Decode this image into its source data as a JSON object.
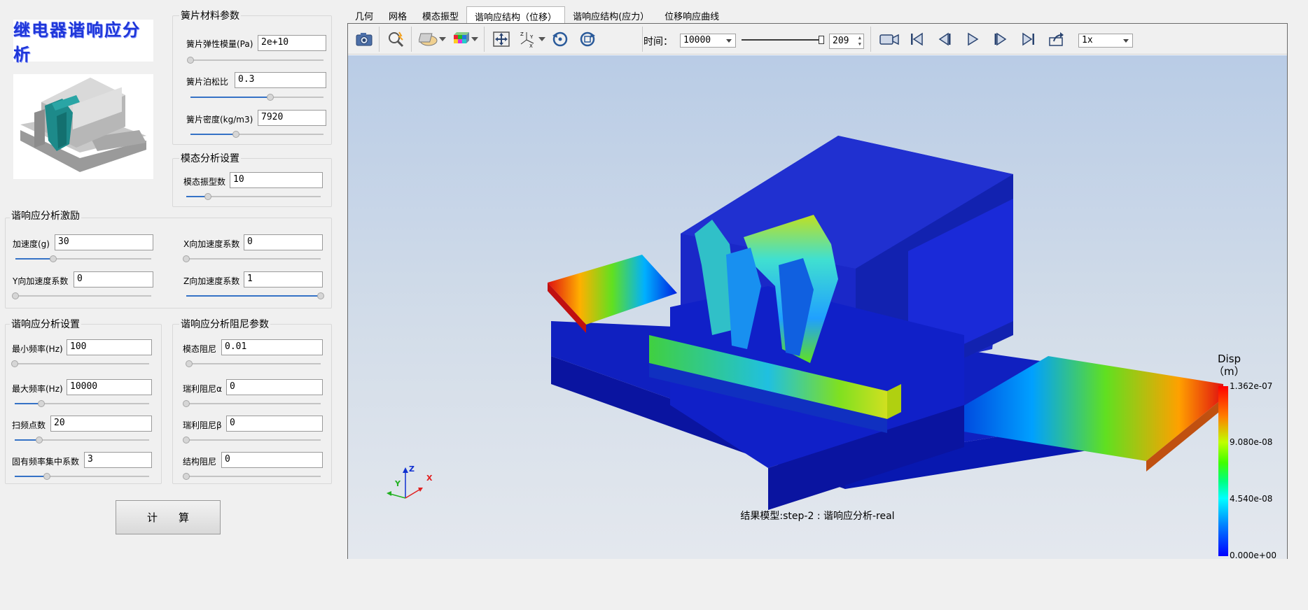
{
  "logo": {
    "text": "继电器谐响应分析"
  },
  "materials": {
    "title": "簧片材料参数",
    "fields": [
      {
        "label": "簧片弹性模量(Pa)",
        "value": "2e+10",
        "slider": 0.0
      },
      {
        "label": "簧片泊松比",
        "value": "0.3",
        "slider": 0.6
      },
      {
        "label": "簧片密度(kg/m3)",
        "value": "7920",
        "slider": 0.4
      }
    ]
  },
  "modal": {
    "title": "模态分析设置",
    "fields": [
      {
        "label": "模态振型数",
        "value": "10",
        "slider": 0.18
      }
    ]
  },
  "excitation": {
    "title": "谐响应分析激励",
    "fields": [
      {
        "label": "加速度(g)",
        "value": "30",
        "slider": 0.3
      },
      {
        "label": "X向加速度系数",
        "value": "0",
        "slider": 0.0
      },
      {
        "label": "Y向加速度系数",
        "value": "0",
        "slider": 0.0
      },
      {
        "label": "Z向加速度系数",
        "value": "1",
        "slider": 1.0
      }
    ]
  },
  "harmonic": {
    "title": "谐响应分析设置",
    "fields": [
      {
        "label": "最小频率(Hz)",
        "value": "100",
        "slider": 0.0
      },
      {
        "label": "最大频率(Hz)",
        "value": "10000",
        "slider": 0.2
      },
      {
        "label": "扫频点数",
        "value": "20",
        "slider": 0.19
      },
      {
        "label": "固有频率集中系数",
        "value": "3",
        "slider": 0.3
      }
    ]
  },
  "damping": {
    "title": "谐响应分析阻尼参数",
    "fields": [
      {
        "label": "模态阻尼",
        "value": "0.01",
        "slider": 0.02
      },
      {
        "label": "瑞利阻尼α",
        "value": "0",
        "slider": 0.0
      },
      {
        "label": "瑞利阻尼β",
        "value": "0",
        "slider": 0.0
      },
      {
        "label": "结构阻尼",
        "value": "0",
        "slider": 0.0
      }
    ]
  },
  "calc_button": {
    "label": "计　　算"
  },
  "tabs": [
    "几何",
    "网格",
    "模态振型",
    "谐响应结构（位移）",
    "谐响应结构(应力）",
    "位移响应曲线"
  ],
  "active_tab": 3,
  "toolbar": {
    "time_label": "时间：",
    "time_value": "10000",
    "frame_value": "209",
    "speed_value": "1x",
    "frame_slider": 1.0
  },
  "legend": {
    "title_line1": "Disp",
    "title_line2": "（m）",
    "values": [
      "1.362e-07",
      "9.080e-08",
      "4.540e-08",
      "0.000e+00"
    ],
    "colors": [
      "#ff0000",
      "#80ff00",
      "#00ffff",
      "#0000ff"
    ]
  },
  "axes": {
    "x": "X",
    "y": "Y",
    "z": "Z"
  },
  "caption": "结果模型:step-2 : 谐响应分析-real"
}
